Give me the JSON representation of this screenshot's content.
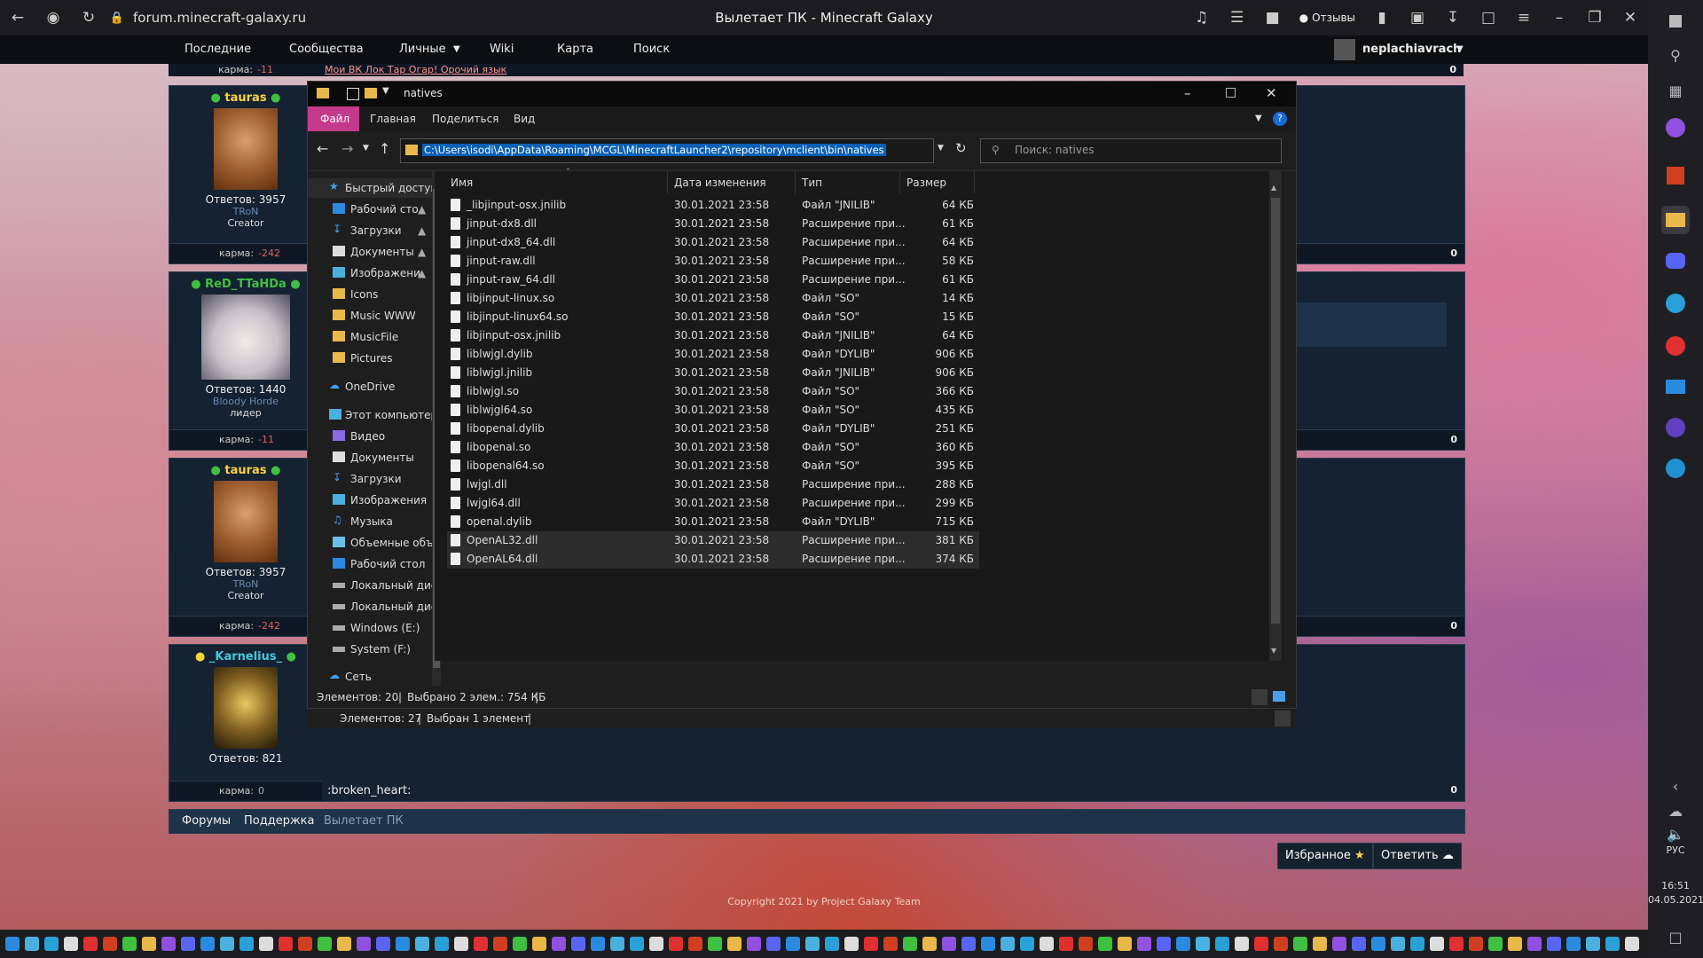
{
  "browser": {
    "url": "forum.minecraft-galaxy.ru",
    "title": "Вылетает ПК - Minecraft Galaxy",
    "feedback_label": "Отзывы"
  },
  "forum_nav": {
    "items": [
      "Последние",
      "Сообщества",
      "Личные",
      "Wiki",
      "Карта",
      "Поиск"
    ],
    "username": "neplachiavrach"
  },
  "top_strip": {
    "karma_label": "карма:",
    "karma_value": "-11",
    "links": "Мои ВК Лок Тар Огар! Орочий язык",
    "zero": "0"
  },
  "posts": [
    {
      "nick": "tauras",
      "nick_color": "#ffd33a",
      "answers": "Ответов: 3957",
      "rank": "TRoN",
      "role": "Creator",
      "karma_label": "карма:",
      "karma": "-242",
      "score": "0"
    },
    {
      "nick": "ReD_TTaHDa",
      "nick_color": "#40c040",
      "answers": "Ответов: 1440",
      "rank": "Bloody Horde",
      "role": "лидер",
      "karma_label": "карма:",
      "karma": "-11",
      "score": "0"
    },
    {
      "nick": "tauras",
      "nick_color": "#ffd33a",
      "answers": "Ответов: 3957",
      "rank": "TRoN",
      "role": "Creator",
      "karma_label": "карма:",
      "karma": "-242",
      "score": "0"
    },
    {
      "nick": "_Karnelius_",
      "nick_color": "#40c8e0",
      "answers": "Ответов: 821",
      "rank": "",
      "role": "",
      "karma_label": "карма:",
      "karma": "0",
      "score": "0",
      "message": ":broken_heart:"
    }
  ],
  "explorer": {
    "title": "natives",
    "ribbon_tabs": [
      "Файл",
      "Главная",
      "Поделиться",
      "Вид"
    ],
    "address": "C:\\Users\\isodi\\AppData\\Roaming\\MCGL\\MinecraftLauncher2\\repository\\mclient\\bin\\natives",
    "search_placeholder": "Поиск: natives",
    "nav_items": [
      "Быстрый доступ",
      "Рабочий сто",
      "Загрузки",
      "Документы",
      "Изображени",
      "Icons",
      "Music WWW",
      "MusicFile",
      "Pictures",
      "OneDrive",
      "Этот компьютер",
      "Видео",
      "Документы",
      "Загрузки",
      "Изображения",
      "Музыка",
      "Объемные объ",
      "Рабочий стол",
      "Локальный дис",
      "Локальный дис",
      "Windows (E:)",
      "System (F:)",
      "Сеть"
    ],
    "columns": [
      "Имя",
      "Дата изменения",
      "Тип",
      "Размер"
    ],
    "files": [
      {
        "name": "_libjinput-osx.jnilib",
        "date": "30.01.2021 23:58",
        "type": "Файл \"JNILIB\"",
        "size": "64 КБ"
      },
      {
        "name": "jinput-dx8.dll",
        "date": "30.01.2021 23:58",
        "type": "Расширение при...",
        "size": "61 КБ"
      },
      {
        "name": "jinput-dx8_64.dll",
        "date": "30.01.2021 23:58",
        "type": "Расширение при...",
        "size": "64 КБ"
      },
      {
        "name": "jinput-raw.dll",
        "date": "30.01.2021 23:58",
        "type": "Расширение при...",
        "size": "58 КБ"
      },
      {
        "name": "jinput-raw_64.dll",
        "date": "30.01.2021 23:58",
        "type": "Расширение при...",
        "size": "61 КБ"
      },
      {
        "name": "libjinput-linux.so",
        "date": "30.01.2021 23:58",
        "type": "Файл \"SO\"",
        "size": "14 КБ"
      },
      {
        "name": "libjinput-linux64.so",
        "date": "30.01.2021 23:58",
        "type": "Файл \"SO\"",
        "size": "15 КБ"
      },
      {
        "name": "libjinput-osx.jnilib",
        "date": "30.01.2021 23:58",
        "type": "Файл \"JNILIB\"",
        "size": "64 КБ"
      },
      {
        "name": "liblwjgl.dylib",
        "date": "30.01.2021 23:58",
        "type": "Файл \"DYLIB\"",
        "size": "906 КБ"
      },
      {
        "name": "liblwjgl.jnilib",
        "date": "30.01.2021 23:58",
        "type": "Файл \"JNILIB\"",
        "size": "906 КБ"
      },
      {
        "name": "liblwjgl.so",
        "date": "30.01.2021 23:58",
        "type": "Файл \"SO\"",
        "size": "366 КБ"
      },
      {
        "name": "liblwjgl64.so",
        "date": "30.01.2021 23:58",
        "type": "Файл \"SO\"",
        "size": "435 КБ"
      },
      {
        "name": "libopenal.dylib",
        "date": "30.01.2021 23:58",
        "type": "Файл \"DYLIB\"",
        "size": "251 КБ"
      },
      {
        "name": "libopenal.so",
        "date": "30.01.2021 23:58",
        "type": "Файл \"SO\"",
        "size": "360 КБ"
      },
      {
        "name": "libopenal64.so",
        "date": "30.01.2021 23:58",
        "type": "Файл \"SO\"",
        "size": "395 КБ"
      },
      {
        "name": "lwjgl.dll",
        "date": "30.01.2021 23:58",
        "type": "Расширение при...",
        "size": "288 КБ"
      },
      {
        "name": "lwjgl64.dll",
        "date": "30.01.2021 23:58",
        "type": "Расширение при...",
        "size": "299 КБ"
      },
      {
        "name": "openal.dylib",
        "date": "30.01.2021 23:58",
        "type": "Файл \"DYLIB\"",
        "size": "715 КБ"
      },
      {
        "name": "OpenAL32.dll",
        "date": "30.01.2021 23:58",
        "type": "Расширение при...",
        "size": "381 КБ"
      },
      {
        "name": "OpenAL64.dll",
        "date": "30.01.2021 23:58",
        "type": "Расширение при...",
        "size": "374 КБ"
      }
    ],
    "status_count": "Элементов: 20",
    "status_selected": "Выбрано 2 элем.: 754 КБ",
    "status2_count": "Элементов: 27",
    "status2_selected": "Выбран 1 элемент"
  },
  "forum_bottom": {
    "crumbs": [
      "Форумы",
      "Поддержка",
      "Вылетает ПК"
    ],
    "favorite_label": "Избранное",
    "reply_label": "Ответить",
    "copyright": "Copyright 2021 by Project Galaxy Team"
  },
  "system_tray": {
    "lang": "РУС",
    "time": "16:51",
    "date": "04.05.2021"
  }
}
